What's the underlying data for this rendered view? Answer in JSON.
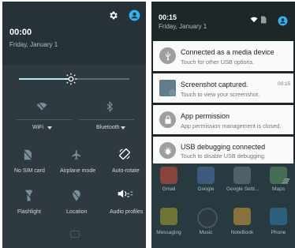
{
  "left": {
    "time": "00:00",
    "date": "Friday, January 1",
    "wifi_label": "WiFi",
    "bluetooth_label": "Bluetooth",
    "tiles": [
      {
        "label": "No SIM card",
        "icon": "no-sim-icon"
      },
      {
        "label": "Airplane mode",
        "icon": "airplane-icon"
      },
      {
        "label": "Auto-rotate",
        "icon": "auto-rotate-icon"
      },
      {
        "label": "Flashlight",
        "icon": "flashlight-icon"
      },
      {
        "label": "Location",
        "icon": "location-icon"
      },
      {
        "label": "Audio profiles",
        "icon": "audio-profiles-icon"
      }
    ],
    "brightness": 0.47,
    "accent": "#29b6f6"
  },
  "right": {
    "time": "00:15",
    "date": "Friday, January 1",
    "notifications": [
      {
        "title": "Connected as a media device",
        "subtitle": "Touch for other USB options.",
        "time": ""
      },
      {
        "title": "Screenshot captured.",
        "subtitle": "Touch to view your screenshot.",
        "time": "00:15"
      },
      {
        "title": "App permission",
        "subtitle": "App permission management is closed.",
        "time": ""
      },
      {
        "title": "USB debugging connected",
        "subtitle": "Touch to disable USB debugging.",
        "time": ""
      }
    ],
    "apps_row1": [
      "Gmail",
      "Google",
      "Google Setti...",
      "Maps"
    ],
    "apps_row2": [
      "Messaging",
      "Music",
      "NoteBook",
      "Phone"
    ]
  }
}
